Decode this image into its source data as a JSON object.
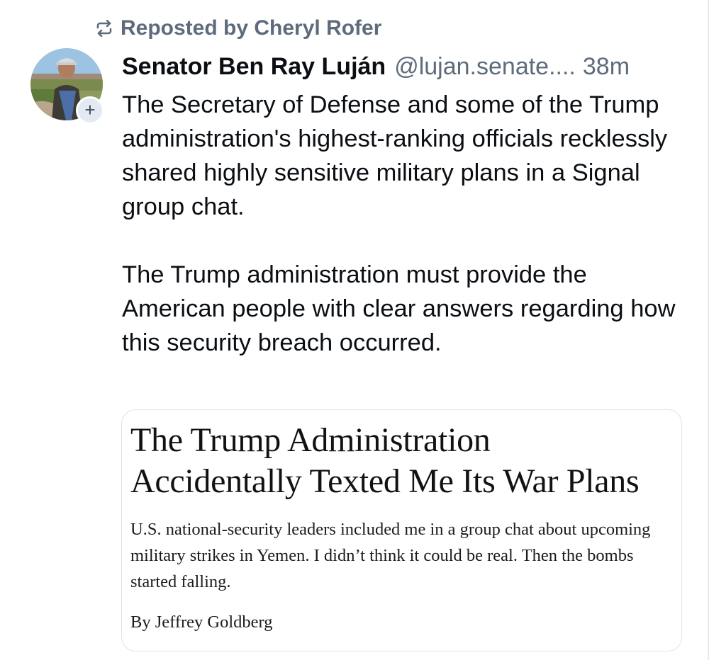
{
  "repost": {
    "label": "Reposted by Cheryl Rofer",
    "icon": "repost-icon"
  },
  "author": {
    "name": "Senator Ben Ray Luján",
    "handle": "@lujan.senate....",
    "time": "38m",
    "avatar_icon": "avatar-photo",
    "follow_icon": "plus-icon",
    "follow_label": "+"
  },
  "post": {
    "paragraphs": [
      "The Secretary of Defense and some of the Trump administration's highest-ranking officials recklessly shared highly sensitive military plans in a Signal group chat.",
      "The Trump administration must provide the American people with clear answers regarding how this security breach occurred."
    ]
  },
  "link_card": {
    "headline_line1": "The Trump Administration",
    "headline_line2": "Accidentally Texted Me Its War Plans",
    "dek": "U.S. national-security leaders included me in a group chat about upcoming military strikes in Yemen. I didn’t think it could be real. Then the bombs started falling.",
    "byline": "By Jeffrey Goldberg"
  },
  "colors": {
    "text": "#0b0f14",
    "muted": "#5d6b7c",
    "card_border": "#dfe4ea"
  }
}
